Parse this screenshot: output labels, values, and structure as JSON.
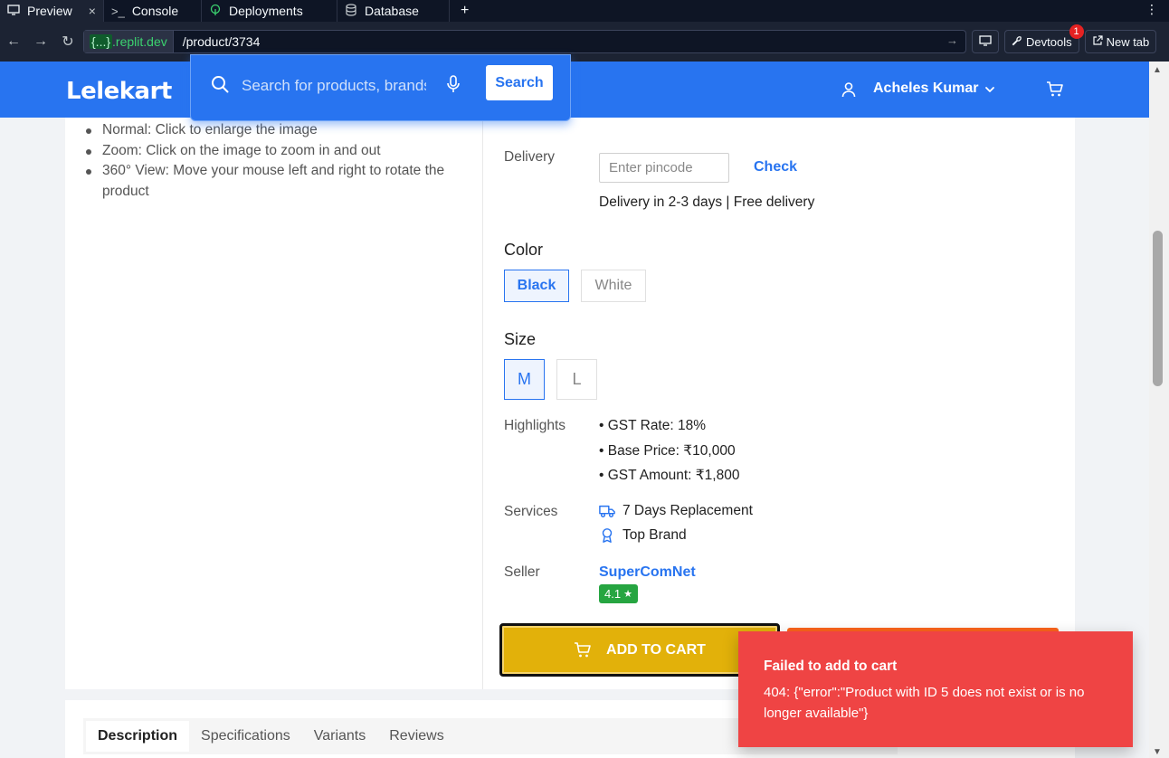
{
  "chrome": {
    "tabs": [
      {
        "label": "Preview",
        "icon": "monitor-icon"
      },
      {
        "label": "Console",
        "icon": "terminal-icon"
      },
      {
        "label": "Deployments",
        "icon": "deploy-icon"
      },
      {
        "label": "Database",
        "icon": "database-icon"
      }
    ],
    "close_glyph": "×",
    "add_glyph": "+",
    "more_glyph": "⋮",
    "url_host_prefix": "{...}",
    "url_host_suffix": ".replit.dev",
    "url_path": "/product/3734",
    "devtools_label": "Devtools",
    "devtools_badge": "1",
    "new_tab_label": "New tab"
  },
  "header": {
    "logo": "Lelekart",
    "search_placeholder": "Search for products, brands and more",
    "search_button": "Search",
    "user_name": "Acheles Kumar",
    "brand_color": "#2874f0"
  },
  "help_list": [
    "Normal: Click to enlarge the image",
    "Zoom: Click on the image to zoom in and out",
    "360° View: Move your mouse left and right to rotate the product"
  ],
  "delivery": {
    "label": "Delivery",
    "pincode_placeholder": "Enter pincode",
    "check_label": "Check",
    "info": "Delivery in 2-3 days | Free delivery"
  },
  "color": {
    "heading": "Color",
    "options": [
      "Black",
      "White"
    ],
    "selected": "Black"
  },
  "size": {
    "heading": "Size",
    "options": [
      "M",
      "L"
    ],
    "selected": "M"
  },
  "highlights": {
    "label": "Highlights",
    "items": [
      "• GST Rate: 18%",
      "• Base Price: ₹10,000",
      "• GST Amount: ₹1,800"
    ]
  },
  "services": {
    "label": "Services",
    "items": [
      {
        "text": "7 Days Replacement",
        "icon": "truck-icon"
      },
      {
        "text": "Top Brand",
        "icon": "award-icon"
      }
    ]
  },
  "seller": {
    "label": "Seller",
    "name": "SuperComNet",
    "rating": "4.1",
    "rating_star": "★"
  },
  "actions": {
    "add_to_cart": "ADD TO CART"
  },
  "product_tabs": [
    "Description",
    "Specifications",
    "Variants",
    "Reviews"
  ],
  "toast": {
    "title": "Failed to add to cart",
    "message": "404: {\"error\":\"Product with ID 5 does not exist or is no longer available\"}"
  }
}
